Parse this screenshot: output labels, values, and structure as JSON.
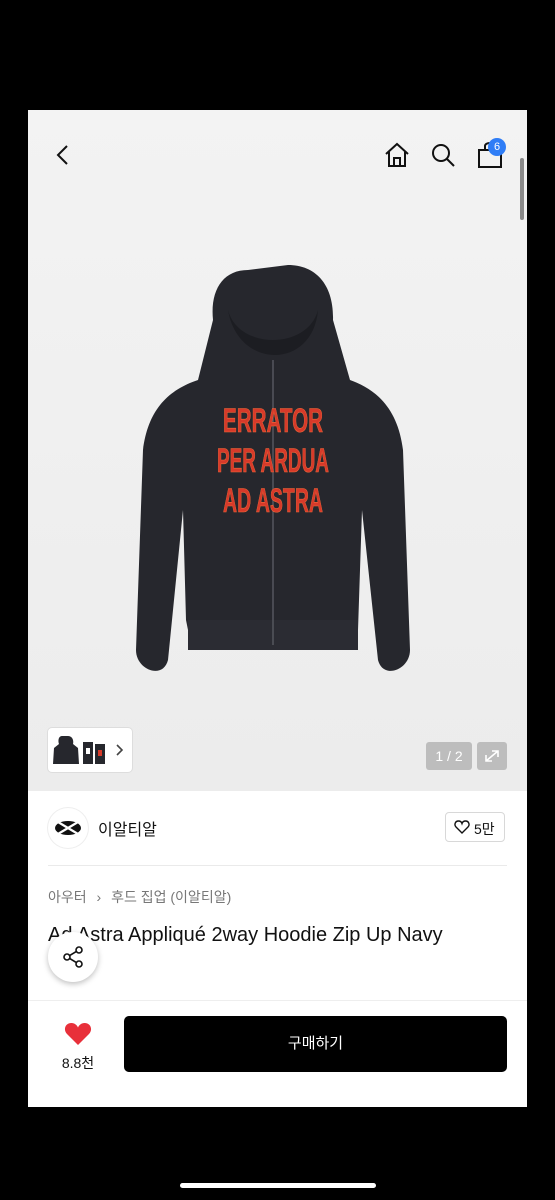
{
  "header": {
    "cart_badge": "6",
    "icons": [
      "chevron-left-icon",
      "home-icon",
      "search-icon",
      "shopping-bag-icon"
    ]
  },
  "gallery": {
    "pager": "1 / 2",
    "print_text": [
      "ERRATOR",
      "PER ARDUA",
      "AD ASTRA"
    ],
    "hoodie_color": "#26272d",
    "print_color": "#d73a2a"
  },
  "store": {
    "name": "이알티알",
    "likes": "5만"
  },
  "product": {
    "breadcrumb": [
      "아우터",
      "후드 집업 (이알티알)"
    ],
    "title": "Ad Astra Appliqué 2way Hoodie Zip Up Navy"
  },
  "bottom": {
    "wish_count": "8.8천",
    "buy_label": "구매하기",
    "heart_color": "#e8303a"
  }
}
